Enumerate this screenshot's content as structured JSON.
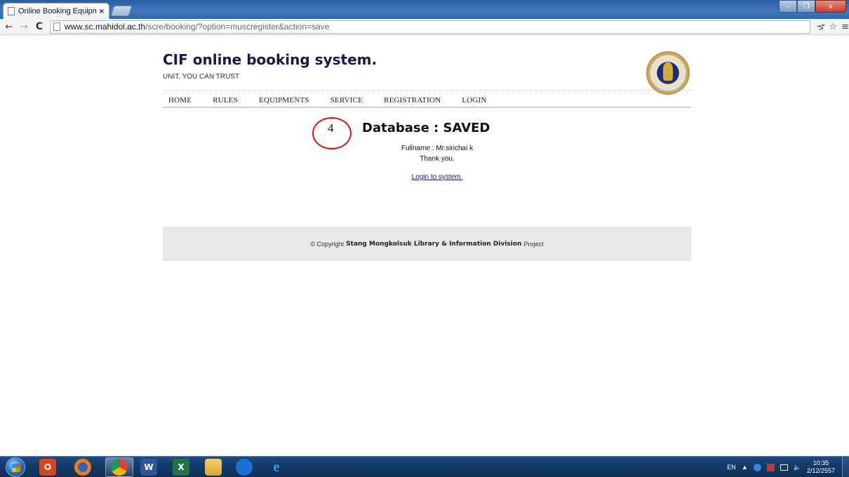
{
  "browser": {
    "tab_title": "Online Booking Equipmen",
    "tab_close": "×",
    "url_host": "www.sc.mahidol.ac.th",
    "url_path": "/scre/booking/?option=muscregister&action=save",
    "nav": {
      "back": "←",
      "forward": "→",
      "reload": "C"
    },
    "toolbar_icons": {
      "extension": "ኇ",
      "star": "☆",
      "menu": "≡"
    },
    "window_controls": {
      "minimize": "–",
      "maximize": "❐",
      "close": "x"
    }
  },
  "site": {
    "title": "CIF online booking system.",
    "slogan": "UNIT, YOU CAN TRUST",
    "menu": [
      "HOME",
      "RULES",
      "EQUIPMENTS",
      "SERVICE",
      "REGISTRATION",
      "LOGIN"
    ]
  },
  "result": {
    "annotation_number": "4",
    "heading": "Database : SAVED",
    "fullname_label": "Fullname : Mr.sirichai k",
    "thanks": "Thank you.",
    "login_link": "Login to system."
  },
  "footer": {
    "prefix": "© Copyright",
    "org": "Stang Mongkolsuk Library & Information Division",
    "suffix": "Project"
  },
  "taskbar": {
    "icons": [
      "start-orb",
      "office-icon",
      "firefox-icon",
      "chrome-icon",
      "word-icon",
      "excel-icon",
      "explorer-icon",
      "teamviewer-icon",
      "ie-icon"
    ],
    "tray_lang": "EN",
    "tray_arrow": "▲",
    "time": "10:35",
    "date": "2/12/2557"
  },
  "colors": {
    "title_blue": "#24124a",
    "annotation_red": "#e01010",
    "footer_bg": "#e8e8e8",
    "link": "#1a1a80"
  }
}
